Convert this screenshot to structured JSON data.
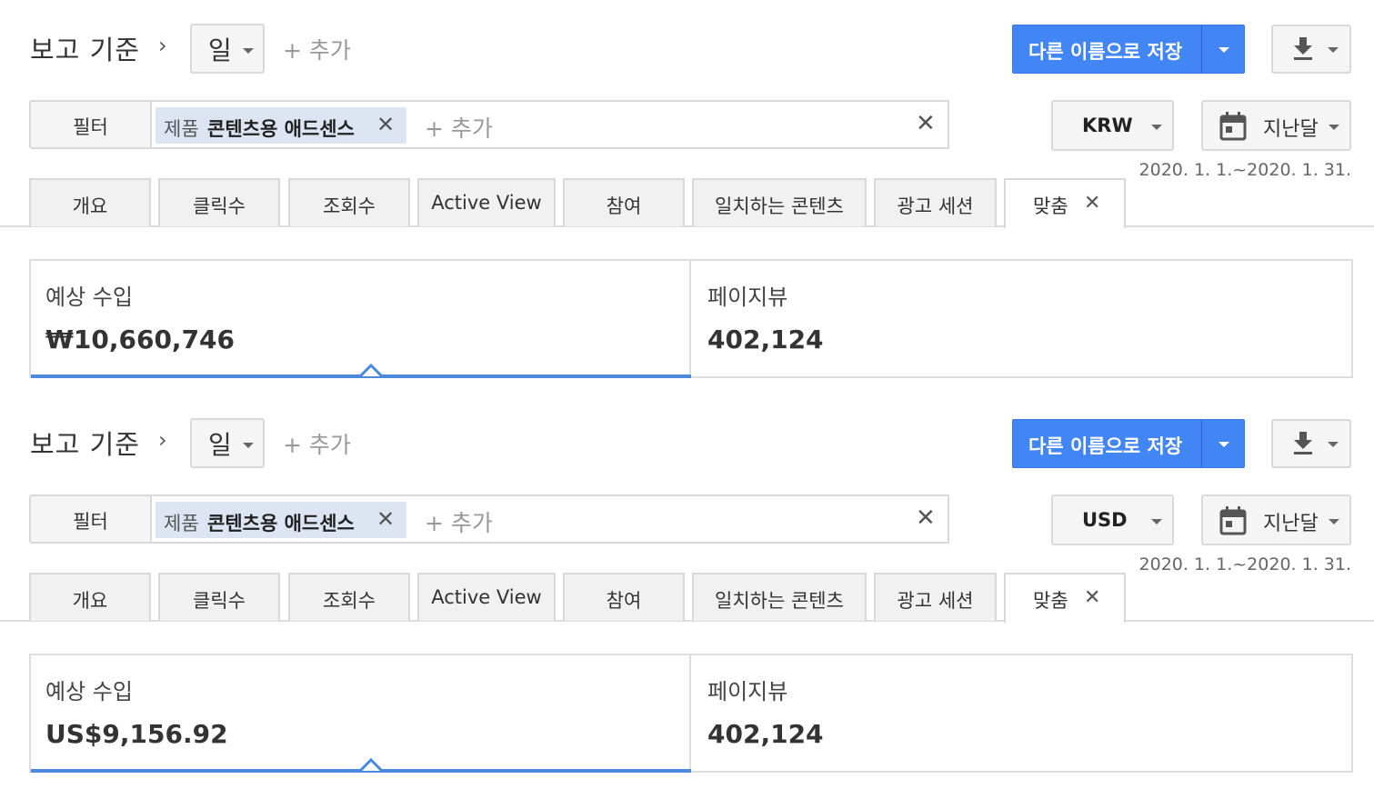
{
  "panels": [
    {
      "report_by_label": "보고 기준",
      "chevron": "›",
      "dimension": "일",
      "add_dimension": "+ 추가",
      "save_button": "다른 이름으로 저장",
      "filter_label": "필터",
      "filter_chip_key": "제품",
      "filter_chip_value": "콘텐츠용 애드센스",
      "filter_add": "+ 추가",
      "currency": "KRW",
      "date_preset": "지난달",
      "date_range": "2020. 1. 1.~2020. 1. 31.",
      "tabs": [
        "개요",
        "클릭수",
        "조회수",
        "Active View",
        "참여",
        "일치하는 콘텐츠",
        "광고 세션",
        "맞춤"
      ],
      "active_tab": "맞춤",
      "metrics": [
        {
          "title": "예상 수입",
          "value": "₩10,660,746"
        },
        {
          "title": "페이지뷰",
          "value": "402,124"
        }
      ]
    },
    {
      "report_by_label": "보고 기준",
      "chevron": "›",
      "dimension": "일",
      "add_dimension": "+ 추가",
      "save_button": "다른 이름으로 저장",
      "filter_label": "필터",
      "filter_chip_key": "제품",
      "filter_chip_value": "콘텐츠용 애드센스",
      "filter_add": "+ 추가",
      "currency": "USD",
      "date_preset": "지난달",
      "date_range": "2020. 1. 1.~2020. 1. 31.",
      "tabs": [
        "개요",
        "클릭수",
        "조회수",
        "Active View",
        "참여",
        "일치하는 콘텐츠",
        "광고 세션",
        "맞춤"
      ],
      "active_tab": "맞춤",
      "metrics": [
        {
          "title": "예상 수입",
          "value": "US$9,156.92"
        },
        {
          "title": "페이지뷰",
          "value": "402,124"
        }
      ]
    }
  ],
  "colors": {
    "accent": "#4285f4",
    "selected_bar": "#4a89dc",
    "chip_bg": "#dde5f3"
  }
}
